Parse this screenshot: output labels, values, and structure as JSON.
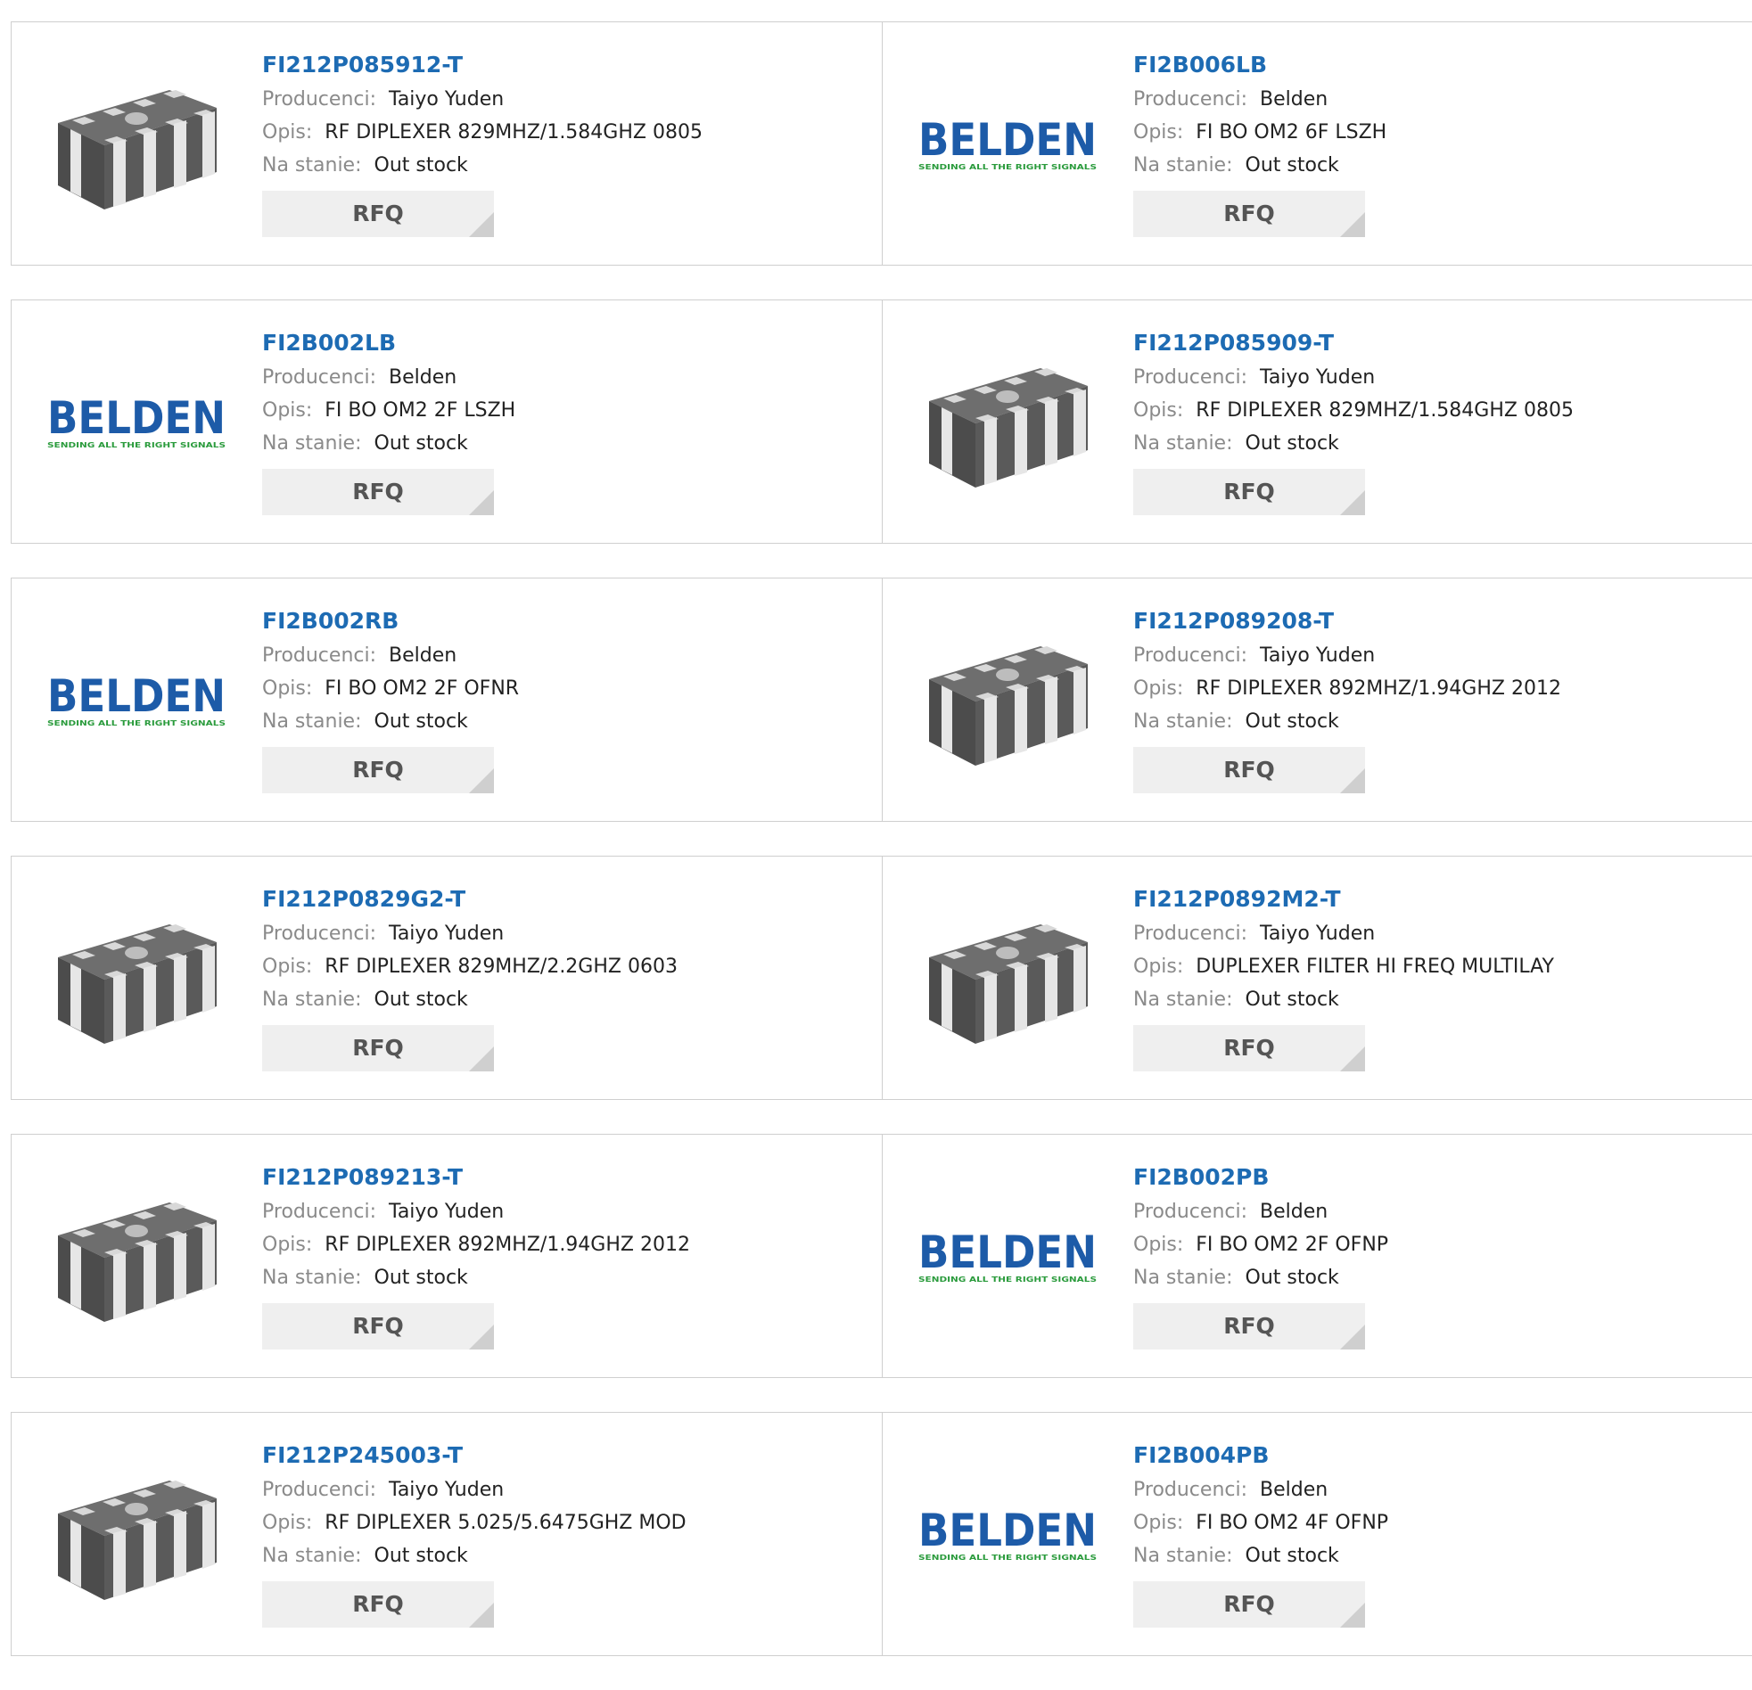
{
  "labels": {
    "manufacturer": "Producenci:",
    "description": "Opis:",
    "stock": "Na stanie:",
    "rfq": "RFQ"
  },
  "brand_logo": {
    "name": "BELDEN",
    "tagline": "SENDING ALL THE RIGHT SIGNALS",
    "color": "#1d5ba8",
    "tagline_color": "#2a9b3c"
  },
  "colors": {
    "link": "#1d6bb3",
    "label": "#8a8a8a",
    "button_bg": "#efefef"
  },
  "rows": [
    {
      "cards": [
        {
          "part": "FI212P085912-T",
          "manufacturer": "Taiyo Yuden",
          "description": "RF DIPLEXER 829MHZ/1.584GHZ 0805",
          "stock": "Out stock",
          "image": "chip-component-image"
        },
        {
          "part": "FI2B006LB",
          "manufacturer": "Belden",
          "description": "FI BO OM2 6F LSZH",
          "stock": "Out stock",
          "image": "belden-logo"
        }
      ]
    },
    {
      "cards": [
        {
          "part": "FI2B002LB",
          "manufacturer": "Belden",
          "description": "FI BO OM2 2F LSZH",
          "stock": "Out stock",
          "image": "belden-logo"
        },
        {
          "part": "FI212P085909-T",
          "manufacturer": "Taiyo Yuden",
          "description": "RF DIPLEXER 829MHZ/1.584GHZ 0805",
          "stock": "Out stock",
          "image": "chip-component-image"
        }
      ]
    },
    {
      "cards": [
        {
          "part": "FI2B002RB",
          "manufacturer": "Belden",
          "description": "FI BO OM2 2F OFNR",
          "stock": "Out stock",
          "image": "belden-logo"
        },
        {
          "part": "FI212P089208-T",
          "manufacturer": "Taiyo Yuden",
          "description": "RF DIPLEXER 892MHZ/1.94GHZ 2012",
          "stock": "Out stock",
          "image": "chip-component-image"
        }
      ]
    },
    {
      "cards": [
        {
          "part": "FI212P0829G2-T",
          "manufacturer": "Taiyo Yuden",
          "description": "RF DIPLEXER 829MHZ/2.2GHZ 0603",
          "stock": "Out stock",
          "image": "chip-component-image"
        },
        {
          "part": "FI212P0892M2-T",
          "manufacturer": "Taiyo Yuden",
          "description": "DUPLEXER FILTER HI FREQ MULTILAY",
          "stock": "Out stock",
          "image": "chip-component-image"
        }
      ]
    },
    {
      "cards": [
        {
          "part": "FI212P089213-T",
          "manufacturer": "Taiyo Yuden",
          "description": "RF DIPLEXER 892MHZ/1.94GHZ 2012",
          "stock": "Out stock",
          "image": "chip-component-image"
        },
        {
          "part": "FI2B002PB",
          "manufacturer": "Belden",
          "description": "FI BO OM2 2F OFNP",
          "stock": "Out stock",
          "image": "belden-logo"
        }
      ]
    },
    {
      "cards": [
        {
          "part": "FI212P245003-T",
          "manufacturer": "Taiyo Yuden",
          "description": "RF DIPLEXER 5.025/5.6475GHZ MOD",
          "stock": "Out stock",
          "image": "chip-component-image"
        },
        {
          "part": "FI2B004PB",
          "manufacturer": "Belden",
          "description": "FI BO OM2 4F OFNP",
          "stock": "Out stock",
          "image": "belden-logo"
        }
      ]
    }
  ]
}
